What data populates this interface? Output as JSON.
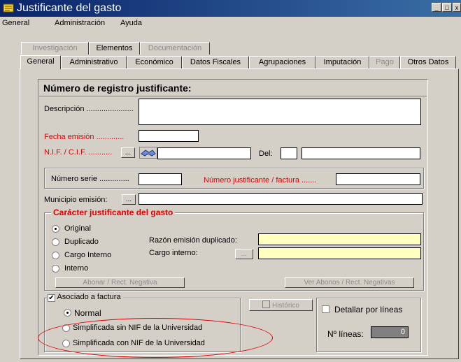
{
  "window": {
    "title": "Justificante del gasto",
    "controls": [
      "_",
      "□",
      "x"
    ]
  },
  "menu": [
    "General",
    "Administración",
    "Ayuda"
  ],
  "top_tabs": [
    {
      "label": "Investigación",
      "disabled": true
    },
    {
      "label": "Elementos",
      "disabled": false
    },
    {
      "label": "Documentación",
      "disabled": true
    }
  ],
  "main_tabs": [
    {
      "label": "General",
      "active": true,
      "disabled": false
    },
    {
      "label": "Administrativo",
      "disabled": false
    },
    {
      "label": "Económico",
      "disabled": false
    },
    {
      "label": "Datos Fiscales",
      "disabled": false
    },
    {
      "label": "Agrupaciones",
      "disabled": false
    },
    {
      "label": "Imputación",
      "disabled": false
    },
    {
      "label": "Pago",
      "disabled": true
    },
    {
      "label": "Otros Datos",
      "disabled": false
    }
  ],
  "form": {
    "header": "Número de registro justificante:",
    "descripcion_label": "Descripción ......................",
    "fecha_label": "Fecha emisión .............",
    "nif_label": "N.I.F. / C.I.F. ...........",
    "nif_button": "...",
    "del_label": "Del:",
    "numero_serie_label": "Número serie ..............",
    "numero_justificante_label": "Número justificante / factura .......",
    "municipio_label": "Municipio emisión:",
    "municipio_button": "...",
    "caracter": {
      "title": "Carácter justificante del gasto",
      "options": [
        "Original",
        "Duplicado",
        "Cargo Interno",
        "Interno"
      ],
      "selected": "Original",
      "razon_label": "Razón emisión duplicado:",
      "cargo_label": "Cargo interno:",
      "cargo_button": "...",
      "abonar_button": "Abonar / Rect. Negativa",
      "ver_abonos_button": "Ver Abonos / Rect. Negativas"
    },
    "asociado": {
      "label": "Asociado a factura",
      "checked": true,
      "options": [
        "Normal",
        "Simplificada sin NIF de la Universidad",
        "Simplificada con NIF de la Universidad"
      ],
      "selected": "Normal"
    },
    "historico_label": "Histórico",
    "detallar_label": "Detallar por líneas",
    "lineas_label": "Nº líneas:",
    "lineas_value": "0"
  },
  "colors": {
    "title_start": "#0a246a",
    "title_end": "#3a6ea5",
    "face": "#d4d0c8",
    "highlight_red": "#e00000",
    "yellow_field": "#ffffc0"
  }
}
